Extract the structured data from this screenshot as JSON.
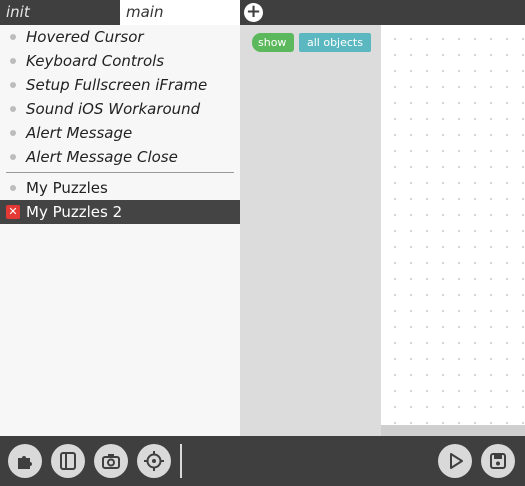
{
  "tabs": [
    {
      "label": "init"
    },
    {
      "label": "main"
    }
  ],
  "sidebar": {
    "italic_items": [
      {
        "label": "Hovered Cursor"
      },
      {
        "label": "Keyboard Controls"
      },
      {
        "label": "Setup Fullscreen iFrame"
      },
      {
        "label": "Sound iOS Workaround"
      },
      {
        "label": "Alert Message"
      },
      {
        "label": "Alert Message Close"
      }
    ],
    "puzzles": [
      {
        "label": "My Puzzles"
      },
      {
        "label": "My Puzzles 2"
      }
    ]
  },
  "flyout": {
    "block_show": "show",
    "block_objects": "all objects"
  },
  "colors": {
    "bar": "#3f3f3f",
    "block_green": "#5cb85c",
    "block_teal": "#5bb8c0",
    "close_red": "#e53935"
  },
  "icons": [
    "plus-icon",
    "puzzle-icon",
    "frame-icon",
    "camera-icon",
    "crosshair-icon",
    "play-icon",
    "save-icon"
  ]
}
